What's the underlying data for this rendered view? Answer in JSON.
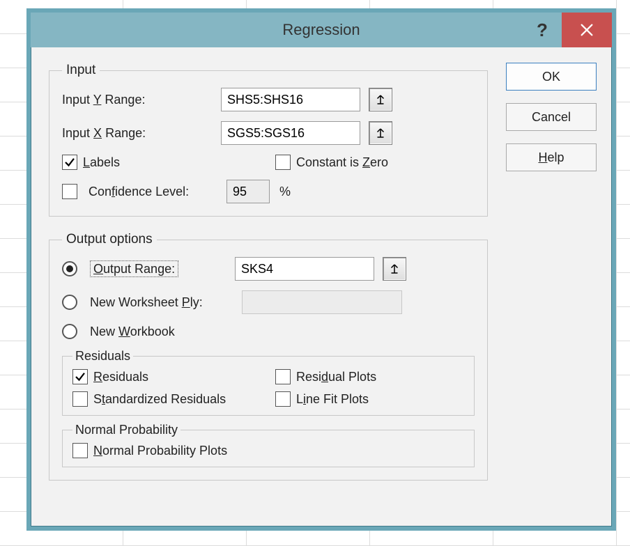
{
  "dialog": {
    "title": "Regression",
    "buttons": {
      "ok": "OK",
      "cancel": "Cancel",
      "help_prefix": "H",
      "help_rest": "elp"
    }
  },
  "input": {
    "legend": "Input",
    "y_label_prefix": "Input ",
    "y_label_u": "Y",
    "y_label_suffix": " Range:",
    "y_value": "SHS5:SHS16",
    "x_label_prefix": "Input ",
    "x_label_u": "X",
    "x_label_suffix": " Range:",
    "x_value": "SGS5:SGS16",
    "labels_u": "L",
    "labels_rest": "abels",
    "labels_checked": true,
    "constzero_prefix": "Constant is ",
    "constzero_u": "Z",
    "constzero_suffix": "ero",
    "constzero_checked": false,
    "conf_prefix": "Con",
    "conf_u": "f",
    "conf_suffix": "idence Level:",
    "conf_checked": false,
    "conf_value": "95",
    "conf_unit": "%"
  },
  "output": {
    "legend": "Output options",
    "range_u": "O",
    "range_rest": "utput Range:",
    "range_selected": true,
    "range_value": "SKS4",
    "newsheet_prefix": "New Worksheet ",
    "newsheet_u": "P",
    "newsheet_suffix": "ly:",
    "newsheet_selected": false,
    "newsheet_value": "",
    "newbook_prefix": "New ",
    "newbook_u": "W",
    "newbook_suffix": "orkbook",
    "newbook_selected": false,
    "residuals": {
      "legend": "Residuals",
      "res_u": "R",
      "res_rest": "esiduals",
      "res_checked": true,
      "std_prefix": "S",
      "std_u": "t",
      "std_suffix": "andardized Residuals",
      "std_checked": false,
      "resplot_prefix": "Resi",
      "resplot_u": "d",
      "resplot_suffix": "ual Plots",
      "resplot_checked": false,
      "linefit_prefix": "L",
      "linefit_u": "i",
      "linefit_suffix": "ne Fit Plots",
      "linefit_checked": false
    },
    "normal": {
      "legend": "Normal Probability",
      "npp_u": "N",
      "npp_rest": "ormal Probability Plots",
      "npp_checked": false
    }
  }
}
